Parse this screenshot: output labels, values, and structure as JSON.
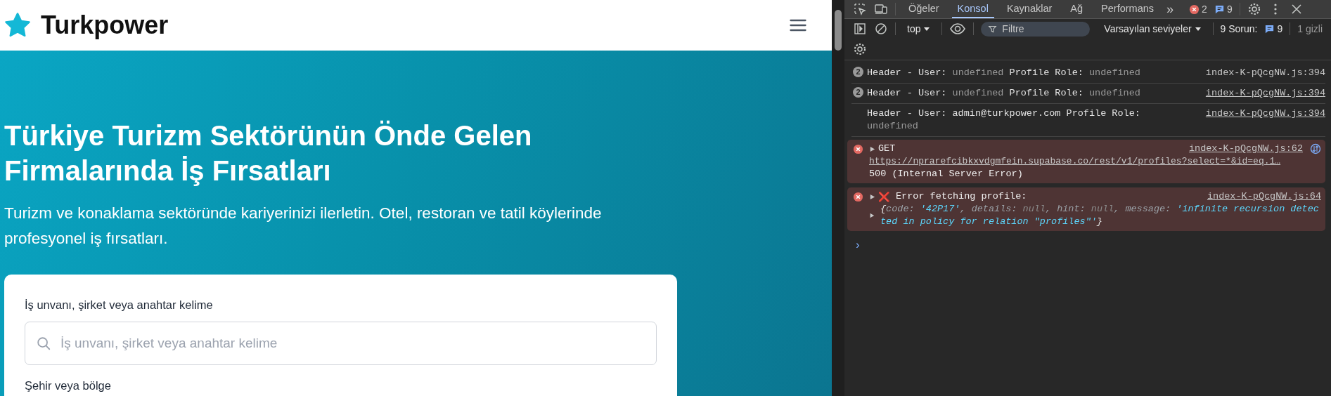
{
  "site": {
    "brand": "Turkpower"
  },
  "hero": {
    "title": "Türkiye Turizm Sektörünün Önde Gelen Firmalarında İş Fırsatları",
    "subtitle": "Turizm ve konaklama sektöründe kariyerinizi ilerletin. Otel, restoran ve tatil köylerinde profesyonel iş fırsatları."
  },
  "search_card": {
    "fields": [
      {
        "label": "İş unvanı, şirket veya anahtar kelime",
        "placeholder": "İş unvanı, şirket veya anahtar kelime"
      },
      {
        "label": "Şehir veya bölge"
      }
    ]
  },
  "devtools": {
    "tabs": [
      {
        "label": "Öğeler",
        "selected": false
      },
      {
        "label": "Konsol",
        "selected": true
      },
      {
        "label": "Kaynaklar",
        "selected": false
      },
      {
        "label": "Ağ",
        "selected": false
      },
      {
        "label": "Performans",
        "selected": false
      }
    ],
    "more_tabs": "»",
    "error_count": "2",
    "message_count": "9",
    "context": "top",
    "filter_placeholder": "Filtre",
    "levels": "Varsayılan seviyeler",
    "issues_label": "9 Sorun:",
    "issues_count": "9",
    "hidden": "1 gizli",
    "messages": [
      {
        "kind": "log",
        "count": "2",
        "parts": [
          {
            "t": "Header - User: ",
            "dim": false
          },
          {
            "t": "undefined",
            "dim": true
          },
          {
            "t": " Profile Role: ",
            "dim": false
          },
          {
            "t": "undefined",
            "dim": true
          }
        ],
        "source": "index-K-pQcgNW.js:394",
        "link": false
      },
      {
        "kind": "log",
        "count": "2",
        "parts": [
          {
            "t": "Header - User: ",
            "dim": false
          },
          {
            "t": "undefined",
            "dim": true
          },
          {
            "t": " Profile Role: ",
            "dim": false
          },
          {
            "t": "undefined",
            "dim": true
          }
        ],
        "source": "index-K-pQcgNW.js:394",
        "link": true
      },
      {
        "kind": "log",
        "parts": [
          {
            "t": "Header - User: admin@turkpower.com Profile Role: ",
            "dim": false
          },
          {
            "t": "undefined",
            "dim": true
          }
        ],
        "source": "index-K-pQcgNW.js:394",
        "link": true
      },
      {
        "kind": "network",
        "method": "GET",
        "url": "https://nprarefcibkxvdgmfein.supabase.co/rest/v1/profiles?select=*&id=eq.1…",
        "status": "500 (Internal Server Error)",
        "source": "index-K-pQcgNW.js:62",
        "link": true
      },
      {
        "kind": "error",
        "emoji": "❌",
        "text": "Error fetching profile:",
        "parts": [
          {
            "t": "{",
            "kind": "brace"
          },
          {
            "t": "code: ",
            "kind": "key"
          },
          {
            "t": "'42P17'",
            "kind": "string"
          },
          {
            "t": ", details: ",
            "kind": "key"
          },
          {
            "t": "null",
            "kind": "null"
          },
          {
            "t": ", hint: ",
            "kind": "key"
          },
          {
            "t": "null",
            "kind": "null"
          },
          {
            "t": ", message: ",
            "kind": "key"
          },
          {
            "t": "'infinite recursion detected in policy for relation \"profiles\"'",
            "kind": "string"
          },
          {
            "t": "}",
            "kind": "brace"
          }
        ],
        "source": "index-K-pQcgNW.js:64",
        "link": true
      }
    ],
    "prompt": "›"
  }
}
